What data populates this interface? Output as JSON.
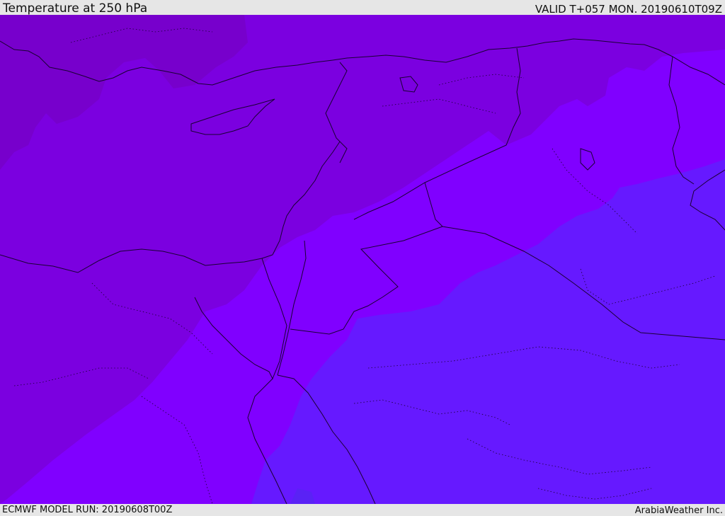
{
  "header": {
    "title": "Temperature at 250 hPa",
    "valid_time": "VALID T+057 MON. 20190610T09Z"
  },
  "footer": {
    "model_run": "ECMWF MODEL RUN: 20190608T00Z",
    "credit": "ArabiaWeather Inc."
  },
  "map": {
    "variable": "temperature",
    "level": "250 hPa",
    "colors": {
      "coldest_band": "#7700cc",
      "cold_band": "#7b00e0",
      "mid_band": "#8000ff",
      "warm_band": "#6619ff",
      "warmest_band": "#5a22f5",
      "border_line": "#1a0033"
    }
  }
}
